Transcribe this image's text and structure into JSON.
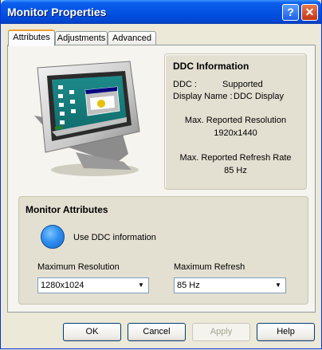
{
  "window": {
    "title": "Monitor Properties",
    "help_glyph": "?",
    "close_glyph": "✕"
  },
  "tabs": [
    {
      "label": "Attributes",
      "active": true
    },
    {
      "label": "Adjustments",
      "active": false
    },
    {
      "label": "Advanced",
      "active": false
    }
  ],
  "ddc_info": {
    "title": "DDC Information",
    "ddc_label": "DDC :",
    "ddc_value": "Supported",
    "display_name_label": "Display Name :",
    "display_name_value": "DDC Display",
    "max_resolution_label": "Max. Reported Resolution",
    "max_resolution_value": "1920x1440",
    "max_refresh_label": "Max. Reported Refresh Rate",
    "max_refresh_value": "85 Hz"
  },
  "attributes": {
    "title": "Monitor Attributes",
    "use_ddc_label": "Use DDC information",
    "max_resolution_label": "Maximum Resolution",
    "max_resolution_value": "1280x1024",
    "max_refresh_label": "Maximum Refresh",
    "max_refresh_value": "85 Hz"
  },
  "buttons": {
    "ok": "OK",
    "cancel": "Cancel",
    "apply": "Apply",
    "help": "Help"
  },
  "colors": {
    "title_bar": "#0554e3",
    "tab_accent": "#f0a030",
    "ddc_button": "#2f8ff0"
  }
}
